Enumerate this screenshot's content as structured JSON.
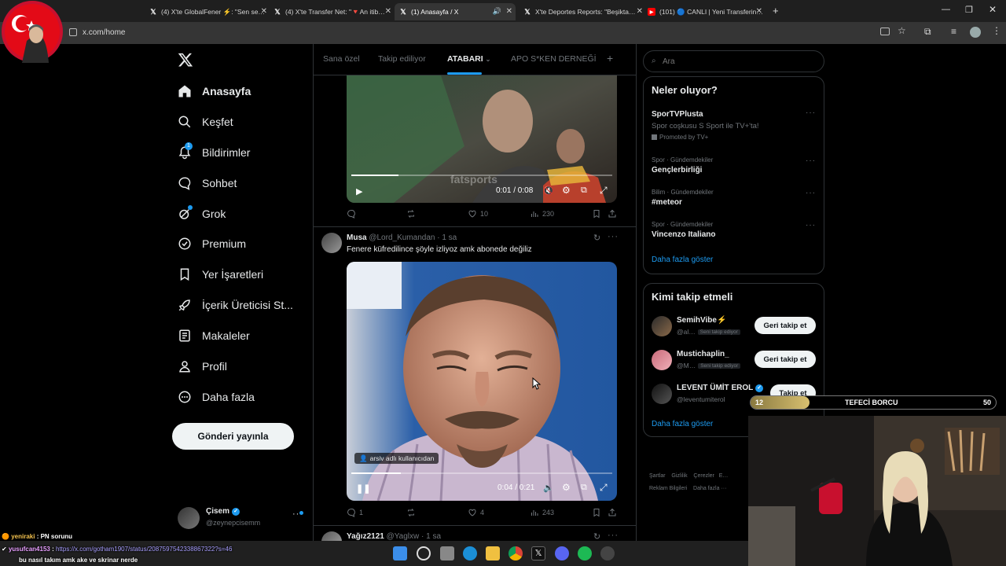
{
  "browser": {
    "tabs": [
      {
        "title": "(4) X'te GlobalFener ⚡: \"Sen se…",
        "favicon": "x-icon"
      },
      {
        "title": "(4) X'te Transfer Net: \"🔻An itib…",
        "favicon": "x-icon"
      },
      {
        "title": "(1) Anasayfa / X",
        "favicon": "x-icon",
        "active": true
      },
      {
        "title": "X'te Deportes Reports: \"Beşikta…",
        "favicon": "x-icon"
      },
      {
        "title": "(101) 🔵 CANLI | Yeni Transferin…",
        "favicon": "youtube-icon"
      }
    ],
    "url": "x.com/home"
  },
  "nav": {
    "items": [
      {
        "label": "Anasayfa",
        "icon": "home-icon"
      },
      {
        "label": "Keşfet",
        "icon": "search-icon"
      },
      {
        "label": "Bildirimler",
        "icon": "bell-icon",
        "badge": "1"
      },
      {
        "label": "Sohbet",
        "icon": "chat-icon"
      },
      {
        "label": "Grok",
        "icon": "grok-icon"
      },
      {
        "label": "Premium",
        "icon": "premium-icon"
      },
      {
        "label": "Yer İşaretleri",
        "icon": "bookmark-icon"
      },
      {
        "label": "İçerik Üreticisi St...",
        "icon": "rocket-icon"
      },
      {
        "label": "Makaleler",
        "icon": "article-icon"
      },
      {
        "label": "Profil",
        "icon": "person-icon"
      },
      {
        "label": "Daha fazla",
        "icon": "more-circle-icon"
      }
    ],
    "post_button": "Gönderi yayınla",
    "account": {
      "name": "Çisem",
      "handle": "@zeynepcisemm"
    }
  },
  "feed": {
    "tabs": [
      "Sana özel",
      "Takip ediliyor",
      "ATABARI",
      "APO S*KEN DERNEĞİ"
    ],
    "active_tab": "ATABARI",
    "post1": {
      "video_time": "0:01 / 0:08",
      "watermark": "fatsports",
      "replies": "",
      "reposts": "",
      "likes": "10",
      "views": "230",
      "progress": 0.18
    },
    "post2": {
      "name": "Musa",
      "handle": "@Lord_Kumandan",
      "time": "· 1 sa",
      "text": "Fenere küfredilince şöyle izliyoz amk abonede değiliz",
      "video_label": "arsiv adlı kullanıcıdan",
      "video_time": "0:04 / 0:21",
      "replies": "1",
      "reposts": "",
      "likes": "4",
      "views": "243",
      "progress": 0.19
    },
    "post3": {
      "name": "Yağız2121",
      "handle": "@Yaglxw",
      "time": "· 1 sa"
    }
  },
  "sidebar": {
    "search_placeholder": "Ara",
    "trends_title": "Neler oluyor?",
    "promoted": {
      "name": "SporTVPlusta",
      "text": "Spor coşkusu S Sport ile TV+'ta!",
      "label": "Promoted by TV+"
    },
    "trends": [
      {
        "category": "Spor · Gündemdekiler",
        "name": "Gençlerbirliği"
      },
      {
        "category": "Bilim · Gündemdekiler",
        "name": "#meteor"
      },
      {
        "category": "Spor · Gündemdekiler",
        "name": "Vincenzo Italiano"
      }
    ],
    "show_more": "Daha fazla göster",
    "who_to_follow_title": "Kimi takip etmeli",
    "who_to_follow": [
      {
        "name": "SemihVibe⚡",
        "handle": "@al…",
        "tag": "Seni takip ediyor",
        "button": "Geri takip et"
      },
      {
        "name": "Mustichaplin_",
        "handle": "@M…",
        "tag": "Seni takip ediyor",
        "button": "Geri takip et"
      },
      {
        "name": "LEVENT ÜMİT EROL",
        "handle": "@leventumiterol",
        "tag": "",
        "button": "Takip et"
      }
    ],
    "show_more2": "Daha fazla göster",
    "footer": [
      "Şartlar",
      "Gizlilik",
      "Çerezler",
      "E…",
      "Reklam Bilgileri",
      "Daha fazla ···"
    ]
  },
  "stream": {
    "goal_title": "TEFECİ BORCU",
    "goal_current": "12",
    "goal_target": "50",
    "goal_fraction": 0.24,
    "chat": [
      {
        "user": "yeniraki",
        "text": "PN sorunu",
        "user_color": "#f2c14e"
      },
      {
        "user": "yusufcan4153",
        "text": "https://x.com/gotham1907/status/2087597542338867322?s=46",
        "user_color": "#e8a0ff"
      },
      {
        "user": "",
        "text": "bu nasıl takım amk ake ve skrinar nerde",
        "user_color": "#ffffff"
      }
    ]
  },
  "colors": {
    "accent": "#1d9bf0",
    "bg": "#000000",
    "muted": "#71767b",
    "border": "#2f3336"
  }
}
